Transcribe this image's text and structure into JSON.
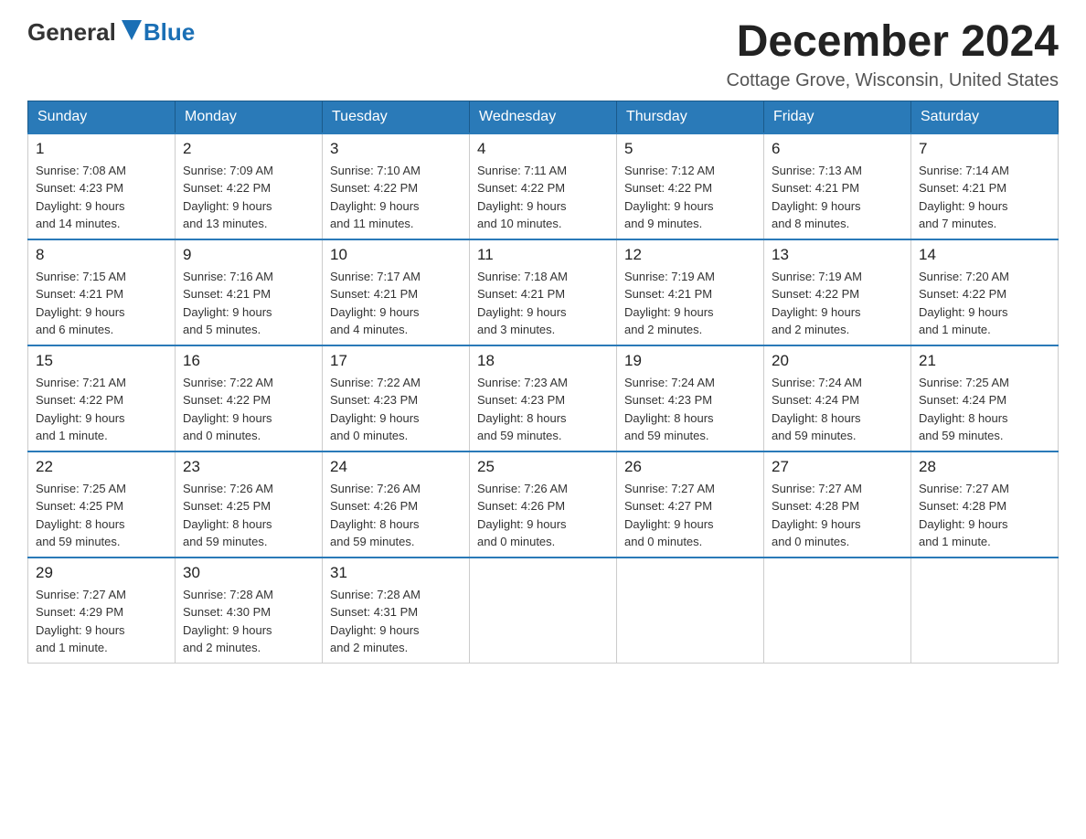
{
  "logo": {
    "general": "General",
    "blue": "Blue"
  },
  "title": {
    "month": "December 2024",
    "location": "Cottage Grove, Wisconsin, United States"
  },
  "days_of_week": [
    "Sunday",
    "Monday",
    "Tuesday",
    "Wednesday",
    "Thursday",
    "Friday",
    "Saturday"
  ],
  "weeks": [
    [
      {
        "day": "1",
        "sunrise": "7:08 AM",
        "sunset": "4:23 PM",
        "daylight": "9 hours and 14 minutes."
      },
      {
        "day": "2",
        "sunrise": "7:09 AM",
        "sunset": "4:22 PM",
        "daylight": "9 hours and 13 minutes."
      },
      {
        "day": "3",
        "sunrise": "7:10 AM",
        "sunset": "4:22 PM",
        "daylight": "9 hours and 11 minutes."
      },
      {
        "day": "4",
        "sunrise": "7:11 AM",
        "sunset": "4:22 PM",
        "daylight": "9 hours and 10 minutes."
      },
      {
        "day": "5",
        "sunrise": "7:12 AM",
        "sunset": "4:22 PM",
        "daylight": "9 hours and 9 minutes."
      },
      {
        "day": "6",
        "sunrise": "7:13 AM",
        "sunset": "4:21 PM",
        "daylight": "9 hours and 8 minutes."
      },
      {
        "day": "7",
        "sunrise": "7:14 AM",
        "sunset": "4:21 PM",
        "daylight": "9 hours and 7 minutes."
      }
    ],
    [
      {
        "day": "8",
        "sunrise": "7:15 AM",
        "sunset": "4:21 PM",
        "daylight": "9 hours and 6 minutes."
      },
      {
        "day": "9",
        "sunrise": "7:16 AM",
        "sunset": "4:21 PM",
        "daylight": "9 hours and 5 minutes."
      },
      {
        "day": "10",
        "sunrise": "7:17 AM",
        "sunset": "4:21 PM",
        "daylight": "9 hours and 4 minutes."
      },
      {
        "day": "11",
        "sunrise": "7:18 AM",
        "sunset": "4:21 PM",
        "daylight": "9 hours and 3 minutes."
      },
      {
        "day": "12",
        "sunrise": "7:19 AM",
        "sunset": "4:21 PM",
        "daylight": "9 hours and 2 minutes."
      },
      {
        "day": "13",
        "sunrise": "7:19 AM",
        "sunset": "4:22 PM",
        "daylight": "9 hours and 2 minutes."
      },
      {
        "day": "14",
        "sunrise": "7:20 AM",
        "sunset": "4:22 PM",
        "daylight": "9 hours and 1 minute."
      }
    ],
    [
      {
        "day": "15",
        "sunrise": "7:21 AM",
        "sunset": "4:22 PM",
        "daylight": "9 hours and 1 minute."
      },
      {
        "day": "16",
        "sunrise": "7:22 AM",
        "sunset": "4:22 PM",
        "daylight": "9 hours and 0 minutes."
      },
      {
        "day": "17",
        "sunrise": "7:22 AM",
        "sunset": "4:23 PM",
        "daylight": "9 hours and 0 minutes."
      },
      {
        "day": "18",
        "sunrise": "7:23 AM",
        "sunset": "4:23 PM",
        "daylight": "8 hours and 59 minutes."
      },
      {
        "day": "19",
        "sunrise": "7:24 AM",
        "sunset": "4:23 PM",
        "daylight": "8 hours and 59 minutes."
      },
      {
        "day": "20",
        "sunrise": "7:24 AM",
        "sunset": "4:24 PM",
        "daylight": "8 hours and 59 minutes."
      },
      {
        "day": "21",
        "sunrise": "7:25 AM",
        "sunset": "4:24 PM",
        "daylight": "8 hours and 59 minutes."
      }
    ],
    [
      {
        "day": "22",
        "sunrise": "7:25 AM",
        "sunset": "4:25 PM",
        "daylight": "8 hours and 59 minutes."
      },
      {
        "day": "23",
        "sunrise": "7:26 AM",
        "sunset": "4:25 PM",
        "daylight": "8 hours and 59 minutes."
      },
      {
        "day": "24",
        "sunrise": "7:26 AM",
        "sunset": "4:26 PM",
        "daylight": "8 hours and 59 minutes."
      },
      {
        "day": "25",
        "sunrise": "7:26 AM",
        "sunset": "4:26 PM",
        "daylight": "9 hours and 0 minutes."
      },
      {
        "day": "26",
        "sunrise": "7:27 AM",
        "sunset": "4:27 PM",
        "daylight": "9 hours and 0 minutes."
      },
      {
        "day": "27",
        "sunrise": "7:27 AM",
        "sunset": "4:28 PM",
        "daylight": "9 hours and 0 minutes."
      },
      {
        "day": "28",
        "sunrise": "7:27 AM",
        "sunset": "4:28 PM",
        "daylight": "9 hours and 1 minute."
      }
    ],
    [
      {
        "day": "29",
        "sunrise": "7:27 AM",
        "sunset": "4:29 PM",
        "daylight": "9 hours and 1 minute."
      },
      {
        "day": "30",
        "sunrise": "7:28 AM",
        "sunset": "4:30 PM",
        "daylight": "9 hours and 2 minutes."
      },
      {
        "day": "31",
        "sunrise": "7:28 AM",
        "sunset": "4:31 PM",
        "daylight": "9 hours and 2 minutes."
      },
      null,
      null,
      null,
      null
    ]
  ],
  "labels": {
    "sunrise": "Sunrise:",
    "sunset": "Sunset:",
    "daylight": "Daylight:"
  }
}
